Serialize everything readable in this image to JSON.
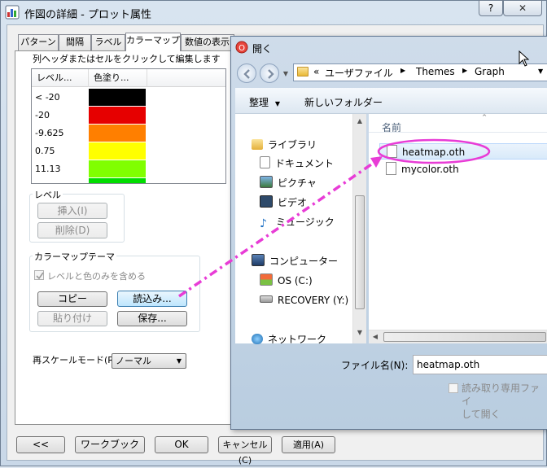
{
  "main_window": {
    "title": "作図の詳細 - プロット属性",
    "help_btn": "?",
    "close_btn": "✕"
  },
  "tabs": [
    {
      "label": "パターン"
    },
    {
      "label": "間隔"
    },
    {
      "label": "ラベル"
    },
    {
      "label": "カラーマップ"
    },
    {
      "label": "数値の表示"
    }
  ],
  "colormap": {
    "hint": "列ヘッダまたはセルをクリックして編集します",
    "col_level": "レベル...",
    "col_fill": "色塗り...",
    "rows": [
      {
        "level": "< -20",
        "color": "#000000"
      },
      {
        "level": "-20",
        "color": "#e60000"
      },
      {
        "level": "-9.625",
        "color": "#ff7f00"
      },
      {
        "level": "0.75",
        "color": "#ffff00"
      },
      {
        "level": "11.13",
        "color": "#80ff00"
      }
    ],
    "last_color": "#00dd00"
  },
  "level_group": {
    "label": "レベル",
    "insert": "挿入(I)",
    "delete": "削除(D)"
  },
  "theme_group": {
    "label": "カラーマップテーマ",
    "checkbox_label": "レベルと色のみを含める",
    "copy": "コピー",
    "load": "読込み...",
    "paste": "貼り付け",
    "save": "保存..."
  },
  "rescale": {
    "label": "再スケールモード(R)",
    "value": "ノーマル"
  },
  "bottom_buttons": {
    "back": "<<",
    "workbook": "ワークブック",
    "ok": "OK",
    "cancel": "キャンセル(C)",
    "apply": "適用(A)"
  },
  "open_dialog": {
    "title": "開く",
    "breadcrumb": [
      "ユーザファイル",
      "Themes",
      "Graph"
    ],
    "breadcrumb_prefix": "«",
    "organize": "整理",
    "new_folder": "新しいフォルダー",
    "column_name": "名前",
    "nav": [
      "ライブラリ",
      "ドキュメント",
      "ピクチャ",
      "ビデオ",
      "ミュージック",
      "コンピューター",
      "OS (C:)",
      "RECOVERY (Y:)",
      "ネットワーク"
    ],
    "files": [
      "heatmap.oth",
      "mycolor.oth"
    ],
    "filename_label": "ファイル名(N):",
    "filename_value": "heatmap.oth",
    "readonly_label_1": "読み取り専用ファイ",
    "readonly_label_2": "して開く"
  },
  "colors": {
    "annotation": "#e83cd6"
  }
}
